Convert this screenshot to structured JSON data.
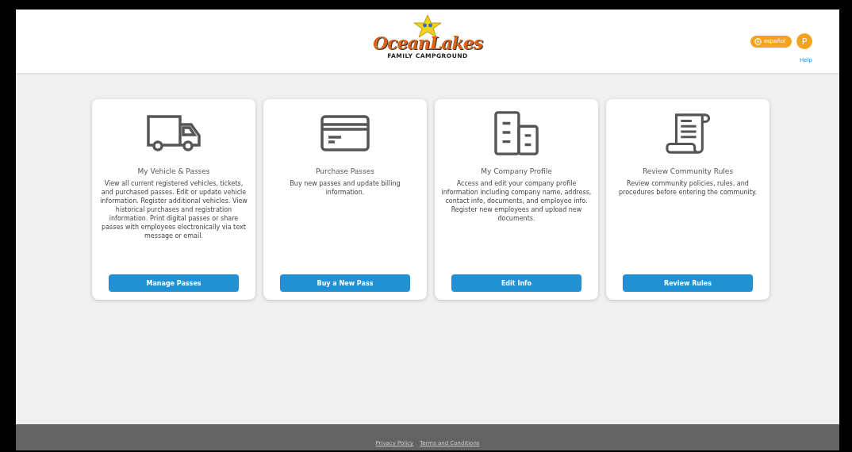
{
  "header": {
    "logo": {
      "name": "OceanLakes",
      "tagline": "FAMILY CAMPGROUND"
    },
    "language_button": "español",
    "avatar": "P",
    "help_link": "Help"
  },
  "cards": [
    {
      "kind": "truck",
      "title": "My Vehicle & Passes",
      "description": "View all current registered vehicles, tickets, and purchased passes. Edit or update vehicle information. Register additional vehicles. View historical purchases and registration information. Print digital passes or share passes with employees electronically via text message or email.",
      "button": "Manage Passes"
    },
    {
      "kind": "card",
      "title": "Purchase Passes",
      "description": "Buy new passes and update billing information.",
      "button": "Buy a New Pass"
    },
    {
      "kind": "building",
      "title": "My Company Profile",
      "description": "Access and edit your company profile information including company name, address, contact info, documents, and employee info. Register new employees and upload new documents.",
      "button": "Edit Info"
    },
    {
      "kind": "scroll",
      "title": "Review Community Rules",
      "description": "Review community policies, rules, and procedures before entering the community.",
      "button": "Review Rules"
    }
  ],
  "footer": {
    "links": [
      "Privacy Policy",
      "Terms and Conditions"
    ]
  }
}
